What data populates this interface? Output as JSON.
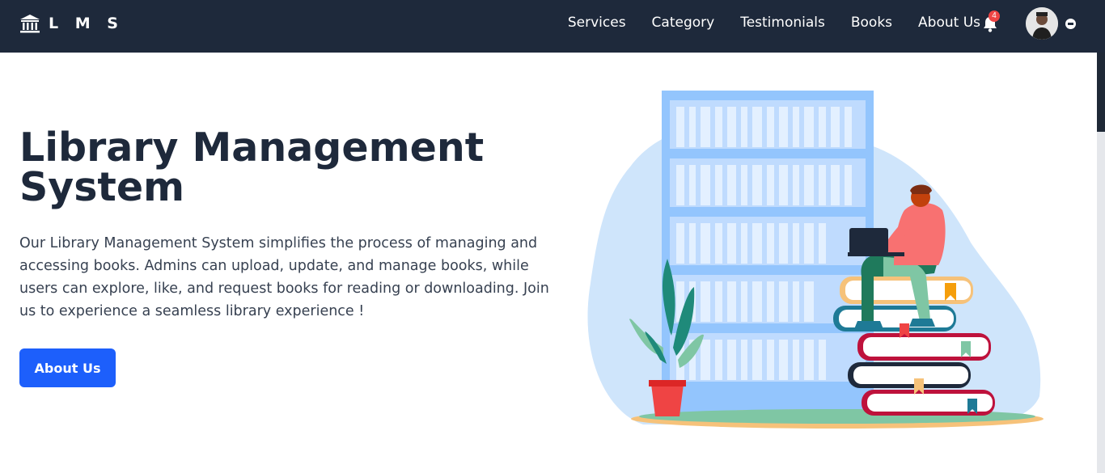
{
  "brand": {
    "name": "L M S",
    "icon": "bank-building-icon"
  },
  "nav": {
    "items": [
      {
        "label": "Services"
      },
      {
        "label": "Category"
      },
      {
        "label": "Testimonials"
      },
      {
        "label": "Books"
      },
      {
        "label": "About Us"
      }
    ],
    "notifications": {
      "icon": "bell-icon",
      "count": "4"
    },
    "profile": {
      "icon": "avatar-photo",
      "menu_icon": "chevron-circle-icon"
    }
  },
  "hero": {
    "title": "Library Management System",
    "description": "Our Library Management System simplifies the process of managing and accessing books. Admins can upload, update, and manage books, while users can explore, like, and request books for reading or downloading. Join us to experience a seamless library experience !",
    "button_label": "About Us"
  },
  "colors": {
    "navbar": "#1e293b",
    "primary_button": "#1d5ffb",
    "title": "#1e293b",
    "badge": "#ef4444"
  }
}
